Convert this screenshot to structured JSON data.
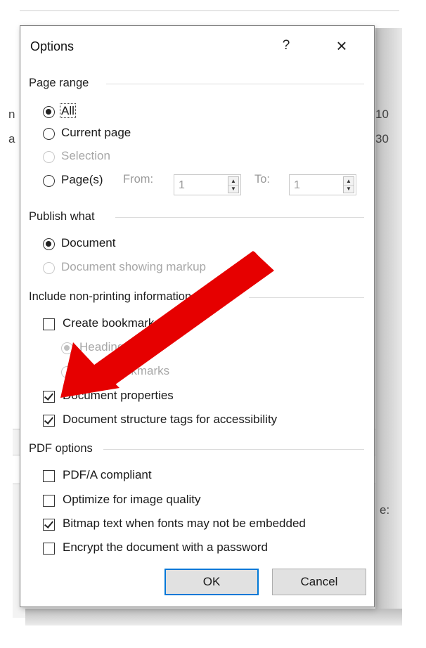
{
  "background": {
    "left_text_1": "n",
    "left_text_2": "a",
    "right_text_1": "10",
    "right_text_2": "30",
    "right_text_3": "e:"
  },
  "dialog": {
    "title": "Options",
    "help_label": "?",
    "close_label": "×"
  },
  "page_range": {
    "label": "Page range",
    "all_label": "All",
    "current_page_label": "Current page",
    "selection_label": "Selection",
    "pages_label": "Page(s)",
    "from_label": "From:",
    "from_value": "1",
    "to_label": "To:",
    "to_value": "1",
    "selected": "All"
  },
  "publish_what": {
    "label": "Publish what",
    "document_label": "Document",
    "markup_label": "Document showing markup",
    "selected": "Document"
  },
  "non_printing": {
    "label": "Include non-printing information",
    "create_bookmarks_label": "Create bookmarks using:",
    "create_bookmarks_checked": false,
    "headings_label": "Headings",
    "word_bookmarks_label": "Word bookmarks",
    "document_properties_label": "Document properties",
    "document_properties_checked": true,
    "structure_tags_label": "Document structure tags for accessibility",
    "structure_tags_checked": true
  },
  "pdf_options": {
    "label": "PDF options",
    "pdfa_label": "PDF/A compliant",
    "pdfa_checked": false,
    "optimize_label": "Optimize for image quality",
    "optimize_checked": false,
    "bitmap_label": "Bitmap text when fonts may not be embedded",
    "bitmap_checked": true,
    "encrypt_label": "Encrypt the document with a password",
    "encrypt_checked": false
  },
  "buttons": {
    "ok_label": "OK",
    "cancel_label": "Cancel"
  },
  "colors": {
    "annotation_arrow": "#e60000",
    "default_button_border": "#0078d7"
  }
}
